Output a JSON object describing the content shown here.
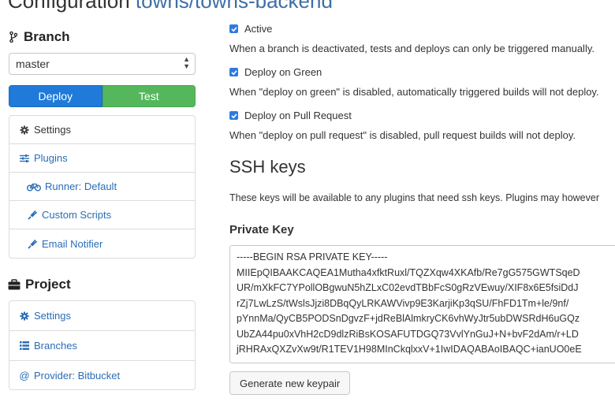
{
  "header": {
    "title_prefix": "Configuration",
    "repo": "towns/towns-backend"
  },
  "branch": {
    "heading": "Branch",
    "selected": "master",
    "deploy_label": "Deploy",
    "test_label": "Test",
    "nav": [
      {
        "label": "Settings",
        "icon": "gear-icon"
      },
      {
        "label": "Plugins",
        "icon": "sliders-icon"
      },
      {
        "label": "Runner: Default",
        "icon": "bicycle-icon"
      },
      {
        "label": "Custom Scripts",
        "icon": "plug-icon"
      },
      {
        "label": "Email Notifier",
        "icon": "plug-icon"
      }
    ]
  },
  "project": {
    "heading": "Project",
    "nav": [
      {
        "label": "Settings",
        "icon": "gear-icon"
      },
      {
        "label": "Branches",
        "icon": "list-icon"
      },
      {
        "label": "Provider: Bitbucket",
        "icon": "at-icon"
      }
    ]
  },
  "options": {
    "active": {
      "label": "Active",
      "checked": true,
      "help": "When a branch is deactivated, tests and deploys can only be triggered manually."
    },
    "deploy_on_green": {
      "label": "Deploy on Green",
      "checked": true,
      "help": "When \"deploy on green\" is disabled, automatically triggered builds will not deploy."
    },
    "deploy_on_pr": {
      "label": "Deploy on Pull Request",
      "checked": true,
      "help": "When \"deploy on pull request\" is disabled, pull request builds will not deploy."
    }
  },
  "ssh": {
    "title": "SSH keys",
    "description": "These keys will be available to any plugins that need ssh keys. Plugins may however",
    "private_key_label": "Private Key",
    "key_lines": [
      "-----BEGIN RSA PRIVATE KEY-----",
      "MIIEpQIBAAKCAQEA1Mutha4xfktRuxl/TQZXqw4XKAfb/Re7gG575GWTSqeD",
      "UR/mXkFC7YPollOBgwuN5hZLxC02evdTBbFcS0gRzVEwuy/XIF8x6E5fsiDdJ",
      "rZj7LwLzS/tWslsJjzi8DBqQyLRKAWVivp9E3KarjiKp3qSU/FhFD1Tm+le/9nf/",
      "pYnnMa/QyCB5PODSnDgvzF+jdReBlAlmkryCK6vhWyJtr5ubDWSRdH6uGQz",
      "UbZA44pu0xVhH2cD9dlzRiBsKOSAFUTDGQ73VvlYnGuJ+N+bvF2dAm/r+LD",
      "jRHRAxQXZvXw9t/R1TEV1H98MInCkqlxxV+1IwIDAQABAoIBAQC+ianUO0eE"
    ],
    "generate_label": "Generate new keypair"
  },
  "colors": {
    "link": "#2a6db5",
    "deploy": "#1f7ad9",
    "test": "#55b75b",
    "checkbox": "#2e7be0"
  }
}
